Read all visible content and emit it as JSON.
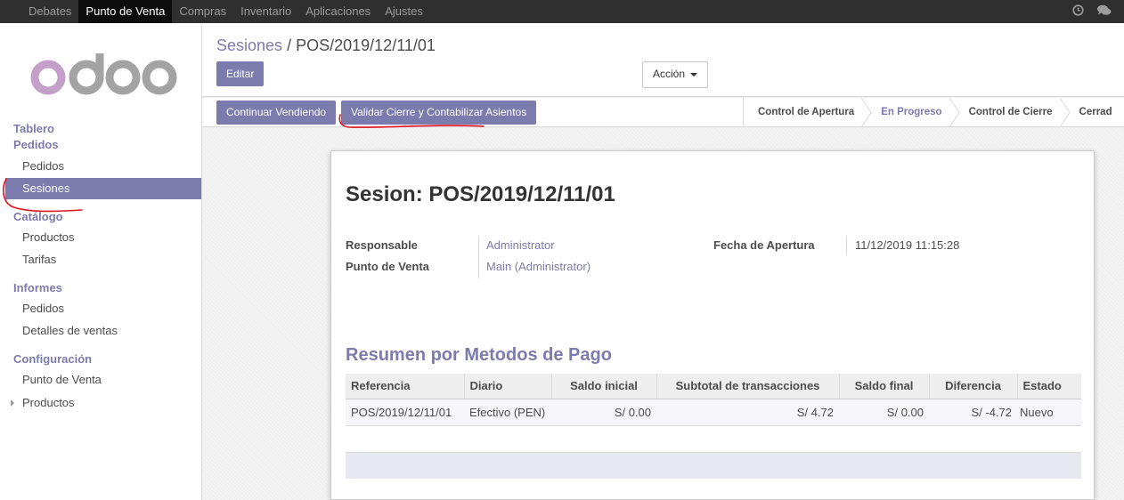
{
  "topbar": {
    "menu": [
      "Debates",
      "Punto de Venta",
      "Compras",
      "Inventario",
      "Aplicaciones",
      "Ajustes"
    ],
    "active_index": 1,
    "icons": [
      "clock-icon",
      "chat-icon"
    ]
  },
  "sidebar": {
    "logo_text": "odoo",
    "groups": [
      {
        "header": "Tablero",
        "items": []
      },
      {
        "header": "Pedidos",
        "items": [
          "Pedidos",
          "Sesiones"
        ]
      },
      {
        "header": "Catálogo",
        "items": [
          "Productos",
          "Tarifas"
        ]
      },
      {
        "header": "Informes",
        "items": [
          "Pedidos",
          "Detalles de ventas"
        ]
      },
      {
        "header": "Configuración",
        "items": [
          "Punto de Venta",
          "Productos"
        ]
      }
    ],
    "active_item": "Sesiones"
  },
  "control_panel": {
    "breadcrumb_parent": "Sesiones",
    "breadcrumb_sep": "/",
    "breadcrumb_current": "POS/2019/12/11/01",
    "edit_button": "Editar",
    "action_button": "Acción"
  },
  "statusbar": {
    "buttons": [
      "Continuar Vendiendo",
      "Validar Cierre y Contabilizar Asientos"
    ],
    "steps": [
      "Control de Apertura",
      "En Progreso",
      "Control de Cierre",
      "Cerrad"
    ],
    "current_step": "En Progreso"
  },
  "form": {
    "title": "Sesion: POS/2019/12/11/01",
    "responsable_label": "Responsable",
    "responsable_value": "Administrator",
    "pos_label": "Punto de Venta",
    "pos_value": "Main (Administrator)",
    "fecha_label": "Fecha de Apertura",
    "fecha_value": "11/12/2019 11:15:28",
    "section_title": "Resumen por Metodos de Pago",
    "table": {
      "columns": [
        "Referencia",
        "Diario",
        "Saldo inicial",
        "Subtotal de transacciones",
        "Saldo final",
        "Diferencia",
        "Estado"
      ],
      "rows": [
        [
          "POS/2019/12/11/01",
          "Efectivo (PEN)",
          "S/ 0.00",
          "S/ 4.72",
          "S/ 0.00",
          "S/ -4.72",
          "Nuevo"
        ]
      ]
    }
  },
  "colors": {
    "brand": "#7c7bad",
    "topbar": "#2f2f2f",
    "annotation": "#e0141e"
  }
}
